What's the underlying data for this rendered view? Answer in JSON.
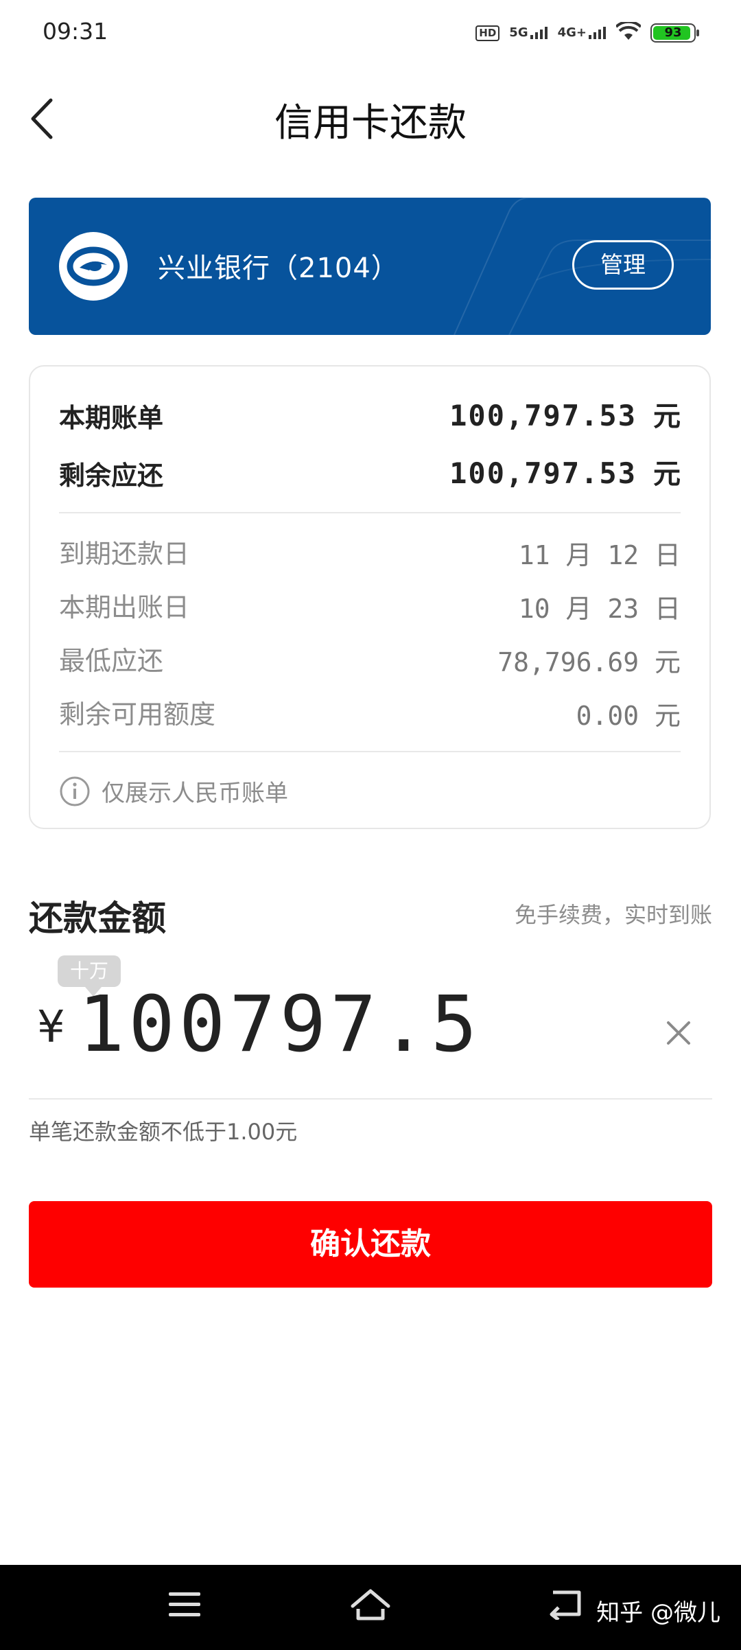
{
  "status_bar": {
    "time": "09:31",
    "network_hd": "HD",
    "network_5g": "5G",
    "network_4g": "4G+",
    "battery_level": "93",
    "battery_color": "#21c421"
  },
  "header": {
    "title": "信用卡还款",
    "back_icon": "chevron-left-icon"
  },
  "bank_card": {
    "name": "兴业银行（2104）",
    "manage_label": "管理",
    "background": "#07539c"
  },
  "bill": {
    "current_bill_label": "本期账单",
    "current_bill_value": "100,797.53",
    "current_bill_unit": "元",
    "remaining_label": "剩余应还",
    "remaining_value": "100,797.53",
    "remaining_unit": "元",
    "details": [
      {
        "label": "到期还款日",
        "value": "11 月 12 日"
      },
      {
        "label": "本期出账日",
        "value": "10 月 23 日"
      },
      {
        "label": "最低应还",
        "value": "78,796.69 元"
      },
      {
        "label": "剩余可用额度",
        "value": "0.00 元"
      }
    ],
    "note": "仅展示人民币账单",
    "note_icon": "info-icon"
  },
  "repayment": {
    "section_title": "还款金额",
    "fee_note": "免手续费，实时到账",
    "unit_tip": "十万",
    "currency": "¥",
    "amount": "100797.5",
    "clear_icon": "close-icon",
    "min_note": "单笔还款金额不低于1.00元"
  },
  "confirm": {
    "label": "确认还款",
    "color": "#fe0000"
  },
  "nav": {
    "menu_icon": "menu-icon",
    "home_icon": "home-icon",
    "back_icon": "back-icon",
    "watermark": "知乎 @微儿"
  }
}
